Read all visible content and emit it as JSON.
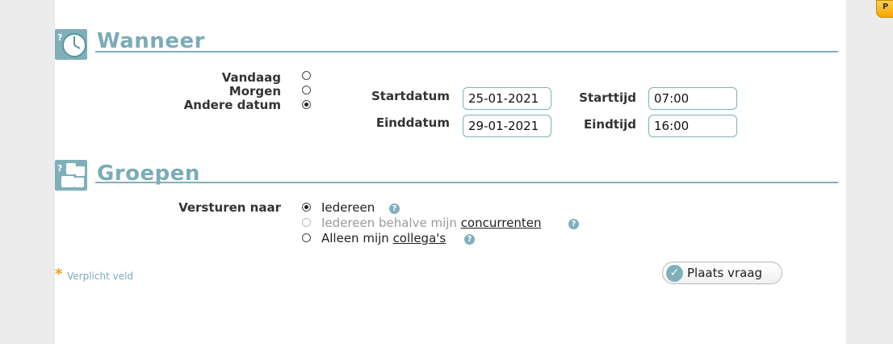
{
  "edge_tab": {
    "label": "P"
  },
  "wanneer": {
    "title": "Wanneer",
    "options": [
      {
        "label": "Vandaag",
        "checked": false
      },
      {
        "label": "Morgen",
        "checked": false
      },
      {
        "label": "Andere datum",
        "checked": true
      }
    ],
    "startdatum_label": "Startdatum",
    "startdatum_value": "25-01-2021",
    "starttijd_label": "Starttijd",
    "starttijd_value": "07:00",
    "einddatum_label": "Einddatum",
    "einddatum_value": "29-01-2021",
    "eindtijd_label": "Eindtijd",
    "eindtijd_value": "16:00"
  },
  "groepen": {
    "title": "Groepen",
    "versturen_label": "Versturen naar",
    "opt1": {
      "text": "Iedereen",
      "checked": true
    },
    "opt2": {
      "text": "Iedereen behalve mijn ",
      "link": "concurrenten",
      "disabled": true
    },
    "opt3": {
      "text": "Alleen mijn ",
      "link": "collega's",
      "checked": false
    }
  },
  "footer": {
    "required_star": "*",
    "required_text": "Verplicht veld",
    "submit_label": "Plaats vraag"
  },
  "colors": {
    "accent": "#7fb0ba",
    "title": "#7aacb7",
    "star": "#f39a1e"
  }
}
